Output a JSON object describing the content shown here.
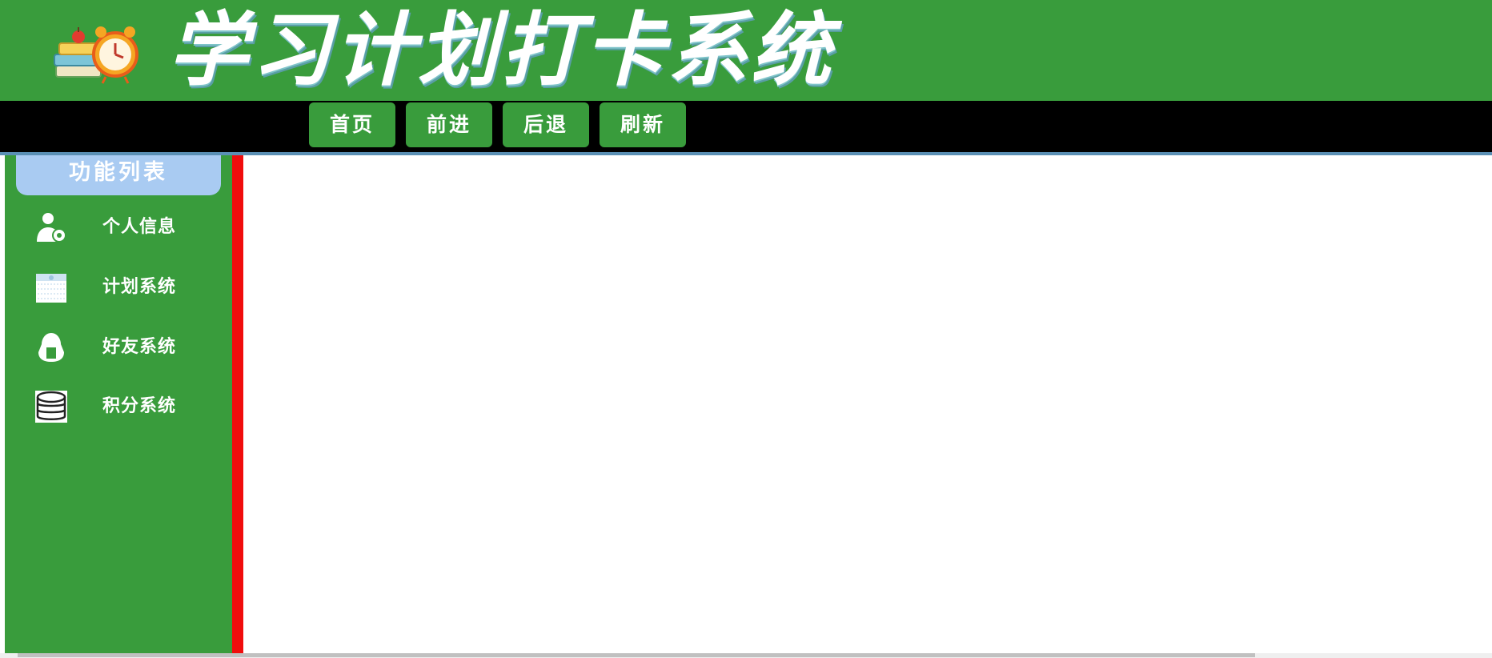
{
  "header": {
    "title": "学习计划打卡系统",
    "logo_icon": "books-alarm-clock-icon"
  },
  "navbar": {
    "buttons": [
      {
        "label": "首页",
        "icon": ""
      },
      {
        "label": "前进",
        "icon": ""
      },
      {
        "label": "后退",
        "icon": ""
      },
      {
        "label": "刷新",
        "icon": ""
      }
    ]
  },
  "sidebar": {
    "title": "功能列表",
    "items": [
      {
        "label": "个人信息",
        "icon": "user-settings-icon"
      },
      {
        "label": "计划系统",
        "icon": "calendar-icon"
      },
      {
        "label": "好友系统",
        "icon": "friends-icon"
      },
      {
        "label": "积分系统",
        "icon": "coins-stack-icon"
      }
    ]
  },
  "colors": {
    "header_green": "#399c3c",
    "navbar_black": "#000000",
    "sidebar_title_blue": "#a9cbf2",
    "separator_red": "#f00d0d"
  }
}
